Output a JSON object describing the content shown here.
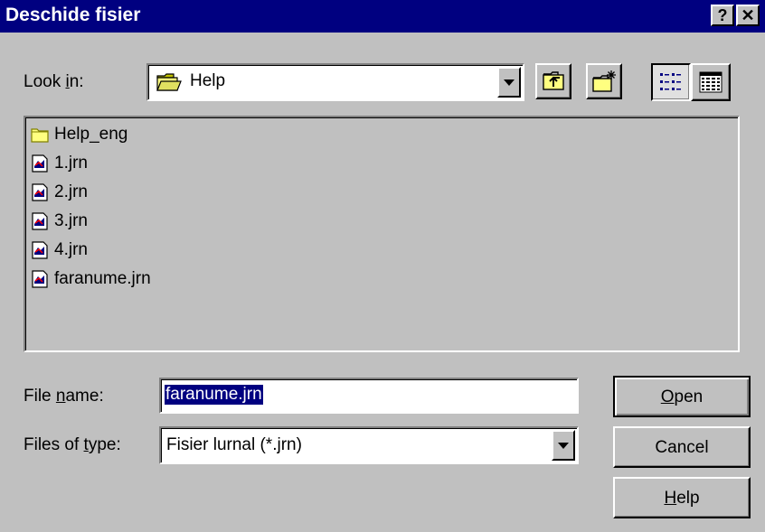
{
  "window": {
    "title": "Deschide fisier",
    "help_glyph": "?",
    "close_glyph": "✕"
  },
  "lookin": {
    "label_pre": "Look ",
    "label_accel": "i",
    "label_post": "n:",
    "value": "Help",
    "icon": "open-folder-icon"
  },
  "toolbar": {
    "up_icon": "up-one-level-icon",
    "new_folder_icon": "new-folder-icon",
    "list_view_icon": "list-view-icon",
    "details_view_icon": "details-view-icon"
  },
  "files": [
    {
      "name": "Help_eng",
      "icon": "folder-icon"
    },
    {
      "name": "1.jrn",
      "icon": "journal-file-icon"
    },
    {
      "name": "2.jrn",
      "icon": "journal-file-icon"
    },
    {
      "name": "3.jrn",
      "icon": "journal-file-icon"
    },
    {
      "name": "4.jrn",
      "icon": "journal-file-icon"
    },
    {
      "name": "faranume.jrn",
      "icon": "journal-file-icon"
    }
  ],
  "filename": {
    "label_pre": "File ",
    "label_accel": "n",
    "label_post": "ame:",
    "value": "faranume.jrn"
  },
  "filetype": {
    "label_pre": "Files of ",
    "label_accel": "t",
    "label_post": "ype:",
    "value": "Fisier lurnal (*.jrn)"
  },
  "buttons": {
    "open_accel": "O",
    "open_rest": "pen",
    "cancel": "Cancel",
    "help_accel": "H",
    "help_rest": "elp"
  },
  "colors": {
    "titlebar": "#000080",
    "face": "#c0c0c0",
    "selection": "#000080"
  }
}
